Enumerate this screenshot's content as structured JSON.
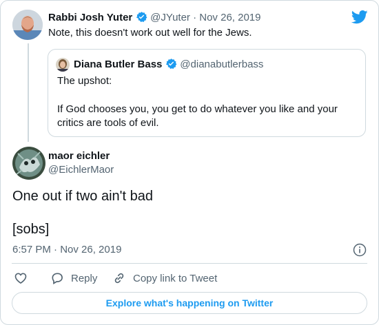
{
  "parent_tweet": {
    "author_name": "Rabbi Josh Yuter",
    "handle_date": "@JYuter · Nov 26, 2019",
    "text": "Note, this doesn't work out well for the Jews."
  },
  "quoted_tweet": {
    "author_name": "Diana Butler Bass",
    "handle": "@dianabutlerbass",
    "line1": "The upshot:",
    "line2": "If God chooses you, you get to do whatever you like and your",
    "line3": "critics are tools of evil."
  },
  "main_tweet": {
    "author_name": "maor eichler",
    "handle": "@EichlerMaor",
    "line1": "One out if two ain't bad",
    "line2": "[sobs]",
    "timestamp": "6:57 PM · Nov 26, 2019"
  },
  "actions": {
    "reply_label": "Reply",
    "copy_link_label": "Copy link to Tweet"
  },
  "explore_label": "Explore what's happening on Twitter",
  "icons": {
    "brand": "twitter-bird-icon",
    "verified": "verified-badge-icon",
    "like": "heart-icon",
    "reply": "speech-bubble-icon",
    "copy": "link-icon",
    "info": "info-icon"
  },
  "colors": {
    "accent": "#1d9bf0",
    "text": "#0f1419",
    "muted": "#536471",
    "border": "#cfd9de"
  }
}
